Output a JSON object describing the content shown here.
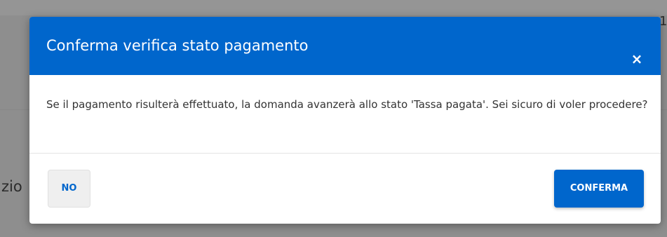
{
  "background": {
    "partial_text_left": "zio",
    "partial_text_right": "1"
  },
  "modal": {
    "title": "Conferma verifica stato pagamento",
    "close_icon": "×",
    "body_text": "Se il pagamento risulterà effettuato, la domanda avanzerà allo stato 'Tassa pagata'. Sei sicuro di voler procedere?",
    "buttons": {
      "no_label": "NO",
      "confirm_label": "CONFERMA"
    },
    "colors": {
      "header": "#0066cc",
      "primary": "#0066cc",
      "secondary_button": "#efefef"
    }
  }
}
